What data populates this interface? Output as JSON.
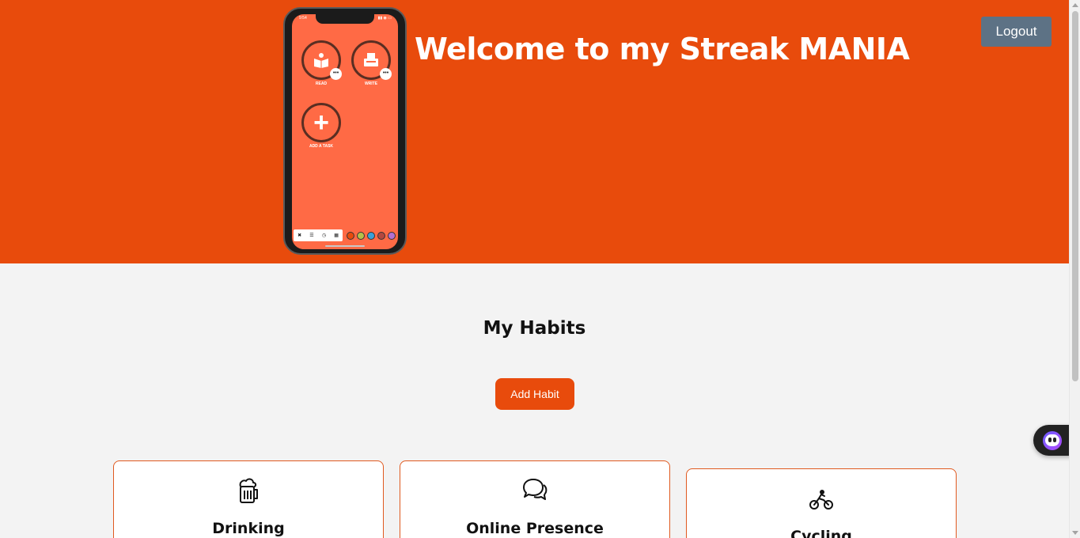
{
  "header": {
    "title": "Welcome to my Streak MANIA",
    "logout_label": "Logout"
  },
  "phone": {
    "status_time": "9:54",
    "tasks": [
      {
        "label": "READ",
        "icon": "book-reader-icon"
      },
      {
        "label": "WRITE",
        "icon": "typewriter-icon"
      }
    ],
    "add_task_label": "ADD A TASK",
    "more_glyph": "•••"
  },
  "habits": {
    "title": "My Habits",
    "add_button_label": "Add Habit",
    "items": [
      {
        "title": "Drinking",
        "icon": "beer-mug-icon"
      },
      {
        "title": "Online Presence",
        "icon": "chat-bubbles-icon"
      },
      {
        "title": "Cycling",
        "icon": "bicycle-icon"
      }
    ]
  },
  "colors": {
    "brand": "#e84b0c",
    "logout_button": "#5d7285",
    "phone_screen": "#ff6a45",
    "background": "#f3f3f3"
  }
}
